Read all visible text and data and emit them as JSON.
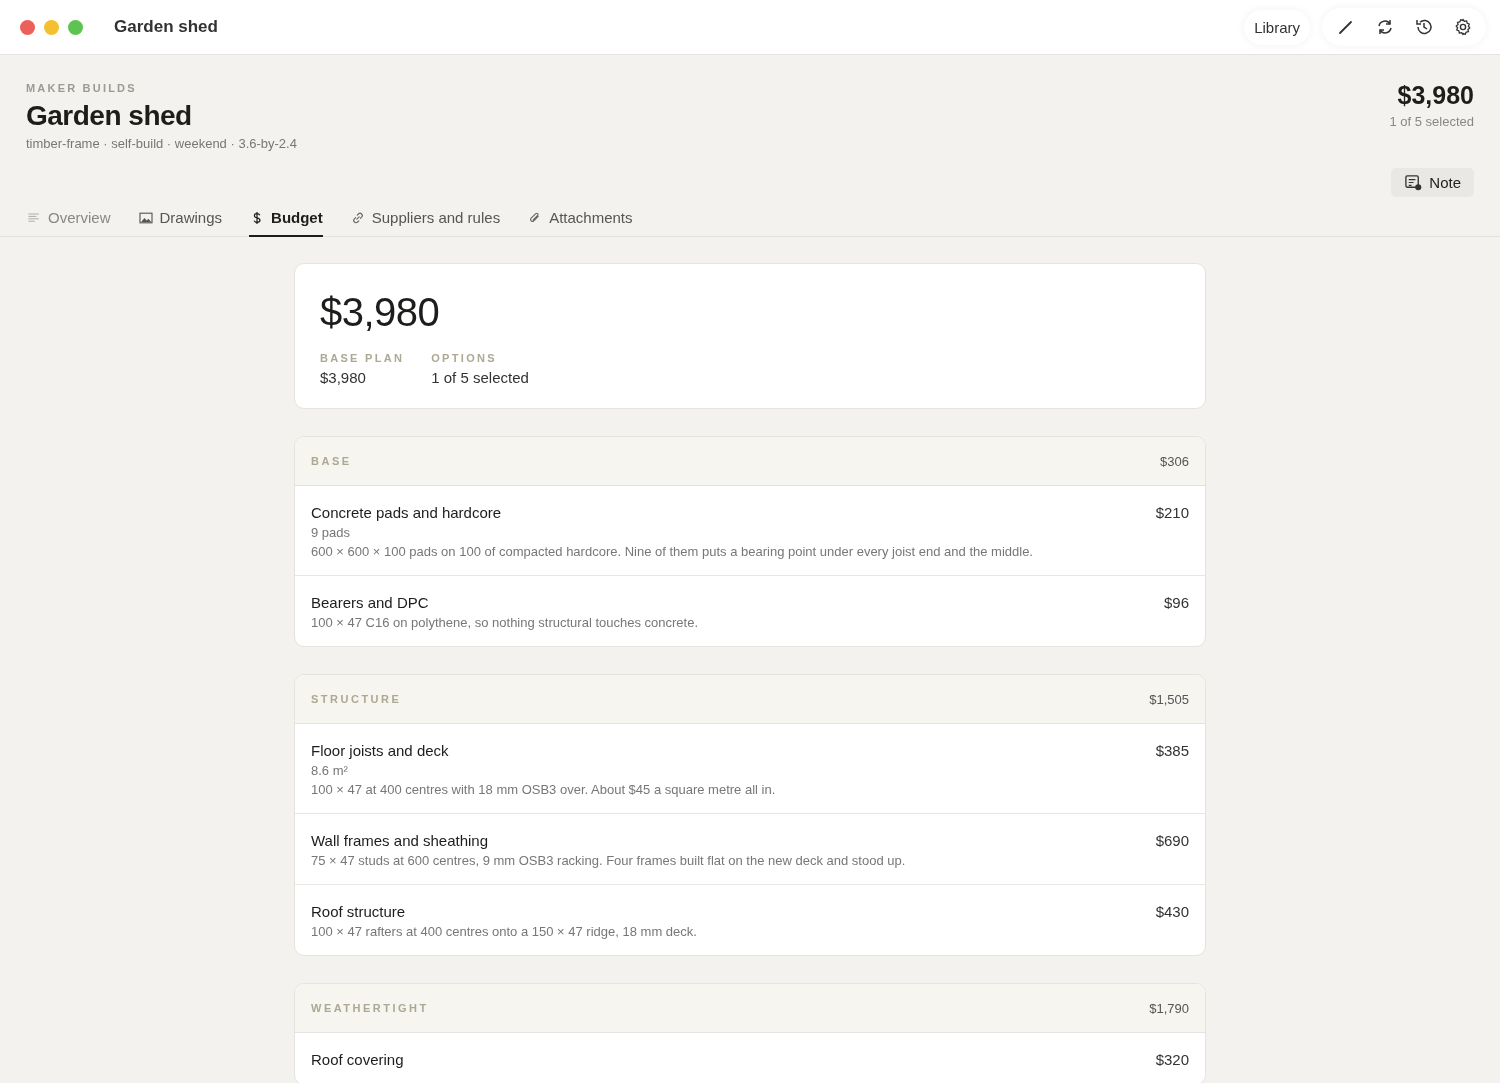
{
  "window": {
    "title": "Garden shed"
  },
  "toolbar": {
    "library": "Library"
  },
  "header": {
    "eyebrow": "MAKER BUILDS",
    "title": "Garden shed",
    "tags": "timber-frame · self-build · weekend · 3.6-by-2.4",
    "total": "$3,980",
    "selection": "1 of 5 selected",
    "note_button": "Note"
  },
  "tabs": [
    {
      "label": "Overview",
      "selected": false
    },
    {
      "label": "Drawings",
      "selected": false
    },
    {
      "label": "Budget",
      "selected": true
    },
    {
      "label": "Suppliers and rules",
      "selected": false
    },
    {
      "label": "Attachments",
      "selected": false
    }
  ],
  "summary": {
    "total": "$3,980",
    "stats": [
      {
        "label": "BASE PLAN",
        "value": "$3,980"
      },
      {
        "label": "OPTIONS",
        "value": "1 of 5 selected"
      }
    ]
  },
  "sections": [
    {
      "name": "BASE",
      "total": "$306",
      "items": [
        {
          "title": "Concrete pads and hardcore",
          "price": "$210",
          "quantity": "9 pads",
          "note": "600 × 600 × 100 pads on 100 of compacted hardcore. Nine of them puts a bearing point under every joist end and the middle."
        },
        {
          "title": "Bearers and DPC",
          "price": "$96",
          "note": "100 × 47 C16 on polythene, so nothing structural touches concrete."
        }
      ]
    },
    {
      "name": "STRUCTURE",
      "total": "$1,505",
      "items": [
        {
          "title": "Floor joists and deck",
          "price": "$385",
          "quantity": "8.6 m²",
          "note": "100 × 47 at 400 centres with 18 mm OSB3 over. About $45 a square metre all in."
        },
        {
          "title": "Wall frames and sheathing",
          "price": "$690",
          "note": "75 × 47 studs at 600 centres, 9 mm OSB3 racking. Four frames built flat on the new deck and stood up."
        },
        {
          "title": "Roof structure",
          "price": "$430",
          "note": "100 × 47 rafters at 400 centres onto a 150 × 47 ridge, 18 mm deck."
        }
      ]
    },
    {
      "name": "WEATHERTIGHT",
      "total": "$1,790",
      "items": [
        {
          "title": "Roof covering",
          "price": "$320"
        }
      ]
    }
  ]
}
